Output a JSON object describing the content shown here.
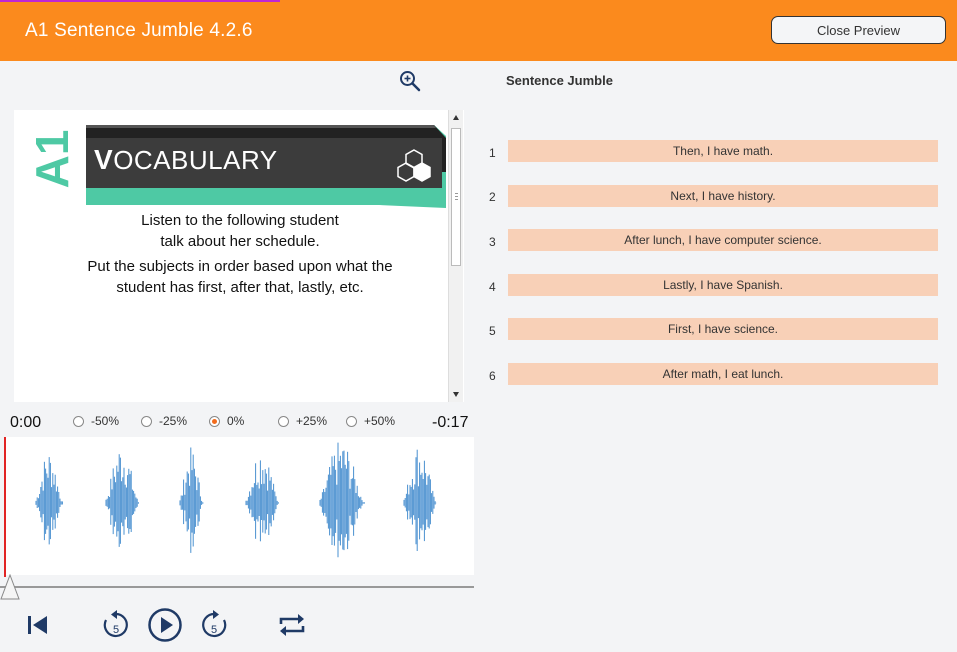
{
  "header": {
    "title": "A1 Sentence Jumble 4.2.6",
    "close_label": "Close Preview"
  },
  "panel": {
    "title": "Sentence Jumble"
  },
  "slide": {
    "badge": "A1",
    "heading_big": "V",
    "heading_rest": "OCABULARY",
    "line1a": "Listen to the following student",
    "line1b": "talk about her schedule.",
    "line2a": "Put the subjects in order based upon what the",
    "line2b": "student has first, after that, lastly, etc."
  },
  "player": {
    "time_start": "0:00",
    "time_end": "-0:17",
    "speeds": [
      {
        "label": "-50%",
        "selected": false
      },
      {
        "label": "-25%",
        "selected": false
      },
      {
        "label": "0%",
        "selected": true
      },
      {
        "label": "+25%",
        "selected": false
      },
      {
        "label": "+50%",
        "selected": false
      }
    ],
    "skip_seconds": "5"
  },
  "sentences": [
    {
      "num": "1",
      "text": "Then, I have math."
    },
    {
      "num": "2",
      "text": "Next, I have history."
    },
    {
      "num": "3",
      "text": "After lunch, I have computer science."
    },
    {
      "num": "4",
      "text": "Lastly, I have Spanish."
    },
    {
      "num": "5",
      "text": "First, I have science."
    },
    {
      "num": "6",
      "text": "After math, I eat lunch."
    }
  ],
  "colors": {
    "accent": "#fb8a1d",
    "sentence_bg": "#f8d0b7",
    "teal": "#4ec9a4",
    "wave": "#4a90d0"
  }
}
